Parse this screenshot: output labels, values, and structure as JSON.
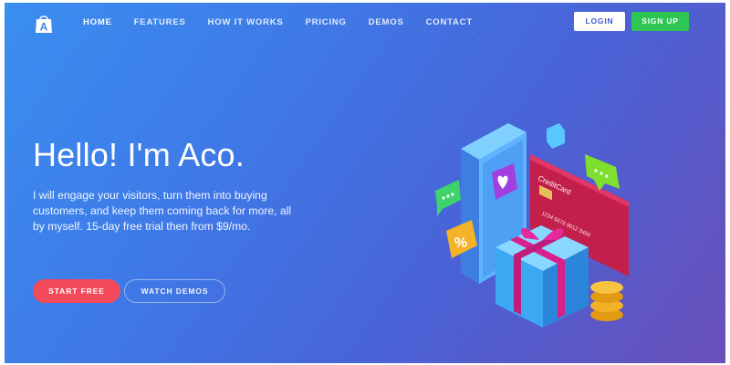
{
  "brand": {
    "logo_letter": "A",
    "logo_icon": "shopping-bag-icon"
  },
  "nav": {
    "items": [
      {
        "label": "HOME",
        "active": true
      },
      {
        "label": "FEATURES"
      },
      {
        "label": "HOW IT WORKS"
      },
      {
        "label": "PRICING"
      },
      {
        "label": "DEMOS"
      },
      {
        "label": "CONTACT"
      }
    ],
    "login_label": "LOGIN",
    "signup_label": "SIGN UP"
  },
  "hero": {
    "title": "Hello! I'm Aco.",
    "text": "I will engage your visitors, turn them into buying customers, and keep them coming back for more, all by myself. 15-day free trial then from $9/mo.",
    "start_label": "START FREE",
    "demos_label": "WATCH DEMOS"
  },
  "illustration": {
    "card_label": "CreditCard",
    "card_number": "1234 5678 9012 3456",
    "percent_symbol": "%"
  },
  "colors": {
    "start_button": "#f2495b",
    "signup_button": "#2dc653",
    "background_start": "#3a8ef0",
    "background_end": "#6a4fb8"
  }
}
